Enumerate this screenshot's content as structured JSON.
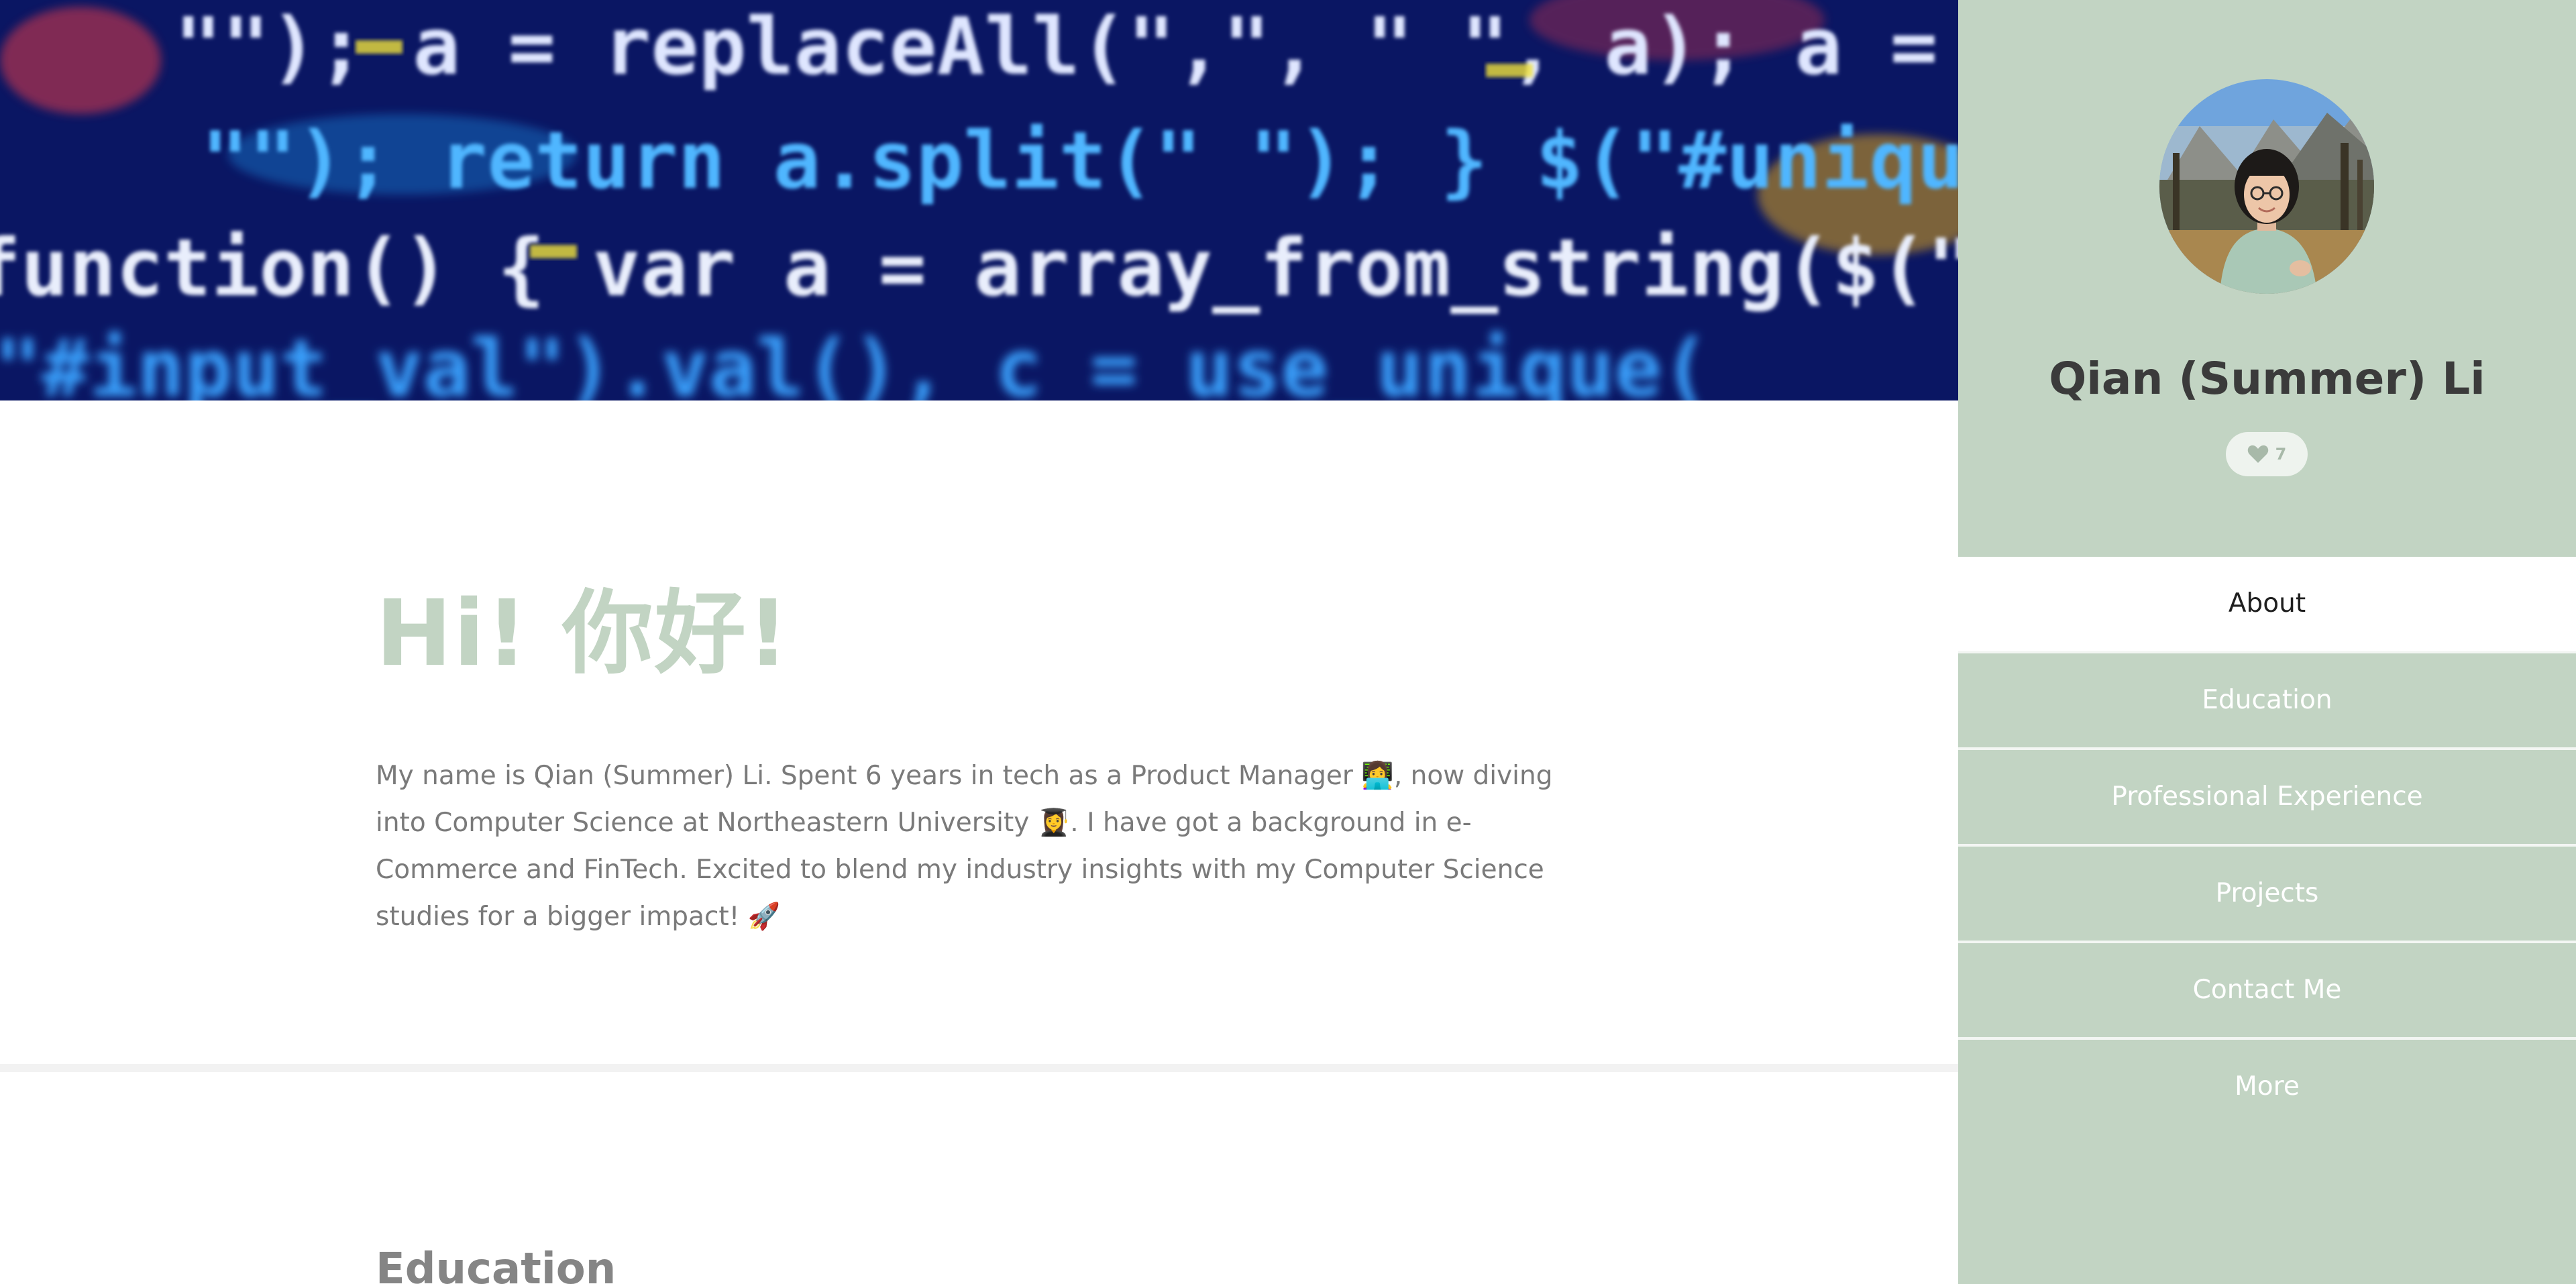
{
  "hero": {
    "code_lines": [
      "\"\"); a = replaceAll(\",\", \" \", a); a = a.replace",
      "\"\"); return a.split(\" \"); } $(\"#unique\").cl",
      "function() { var a = array_from_string($(\"#fin\").va",
      "(\"#input_val\").val(), c = use_unique("
    ]
  },
  "about": {
    "greeting": "Hi! 你好!",
    "intro": "My name is Qian (Summer) Li. Spent 6 years in tech as a Product Manager 👩‍💻, now diving into Computer Science at Northeastern University 👩‍🎓. I have got a background in e-Commerce and FinTech. Excited to blend my industry insights with my Computer Science studies for a bigger impact! 🚀"
  },
  "education": {
    "heading": "Education"
  },
  "sidebar": {
    "name": "Qian (Summer) Li",
    "likes": "7",
    "nav": [
      {
        "label": "About",
        "active": true
      },
      {
        "label": "Education",
        "active": false
      },
      {
        "label": "Professional Experience",
        "active": false
      },
      {
        "label": "Projects",
        "active": false
      },
      {
        "label": "Contact Me",
        "active": false
      },
      {
        "label": "More",
        "active": false
      }
    ]
  },
  "colors": {
    "sidebar_bg": "#c2d4c3",
    "greeting": "#c2d4c3",
    "body_text": "#7a7a7a",
    "name_text": "#3b3b3b",
    "hero_bg": "#0c1a6b"
  },
  "icons": {
    "avatar": "profile-photo",
    "like": "heart-icon"
  }
}
